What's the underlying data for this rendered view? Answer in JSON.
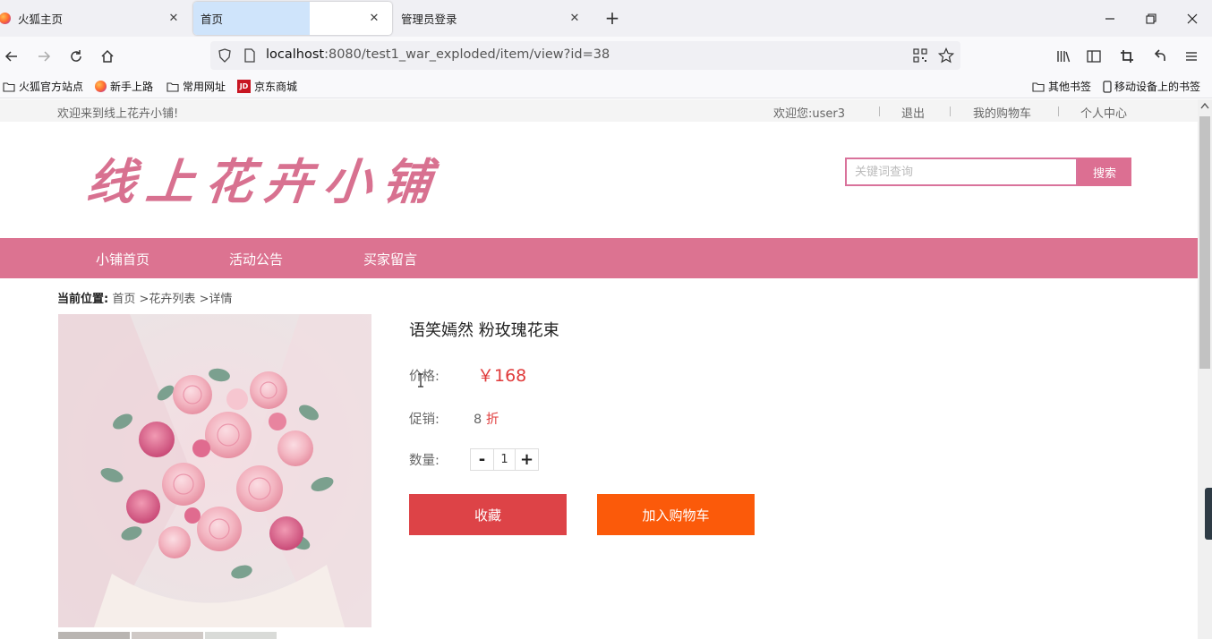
{
  "browser": {
    "tabs": [
      {
        "title": "火狐主页",
        "active": false
      },
      {
        "title": "首页",
        "active": true
      },
      {
        "title": "管理员登录",
        "active": false
      }
    ],
    "new_tab_glyph": "+",
    "close_glyph": "✕",
    "url_host": "localhost",
    "url_rest": ":8080/test1_war_exploded/item/view?id=38",
    "bookmarks": [
      "火狐官方站点",
      "新手上路",
      "常用网址",
      "京东商城"
    ],
    "bookmarks_right": [
      "其他书签",
      "移动设备上的书签"
    ],
    "jd_badge": "JD"
  },
  "site": {
    "welcome": "欢迎来到线上花卉小铺!",
    "user_greeting": "欢迎您:user3",
    "logout": "退出",
    "my_cart": "我的购物车",
    "user_center": "个人中心",
    "logo_text": "线上花卉小铺",
    "search_placeholder": "关键词查询",
    "search_button": "搜索",
    "menu": [
      "小铺首页",
      "活动公告",
      "买家留言"
    ],
    "breadcrumb": {
      "label": "当前位置:",
      "home": "首页",
      "sep": ">",
      "list": "花卉列表",
      "detail": "详情"
    }
  },
  "product": {
    "name": "语笑嫣然 粉玫瑰花束",
    "price_label": "价格:",
    "price": "￥168",
    "promo_label": "促销:",
    "promo_value": "8",
    "promo_unit": "折",
    "qty_label": "数量:",
    "qty_minus": "-",
    "qty_value": "1",
    "qty_plus": "+",
    "fav_button": "收藏",
    "cart_button": "加入购物车"
  },
  "colors": {
    "brand_pink": "#dc7391",
    "price_red": "#e03a3a",
    "fav_red": "#dd4347",
    "cart_orange": "#fb5a0a"
  }
}
